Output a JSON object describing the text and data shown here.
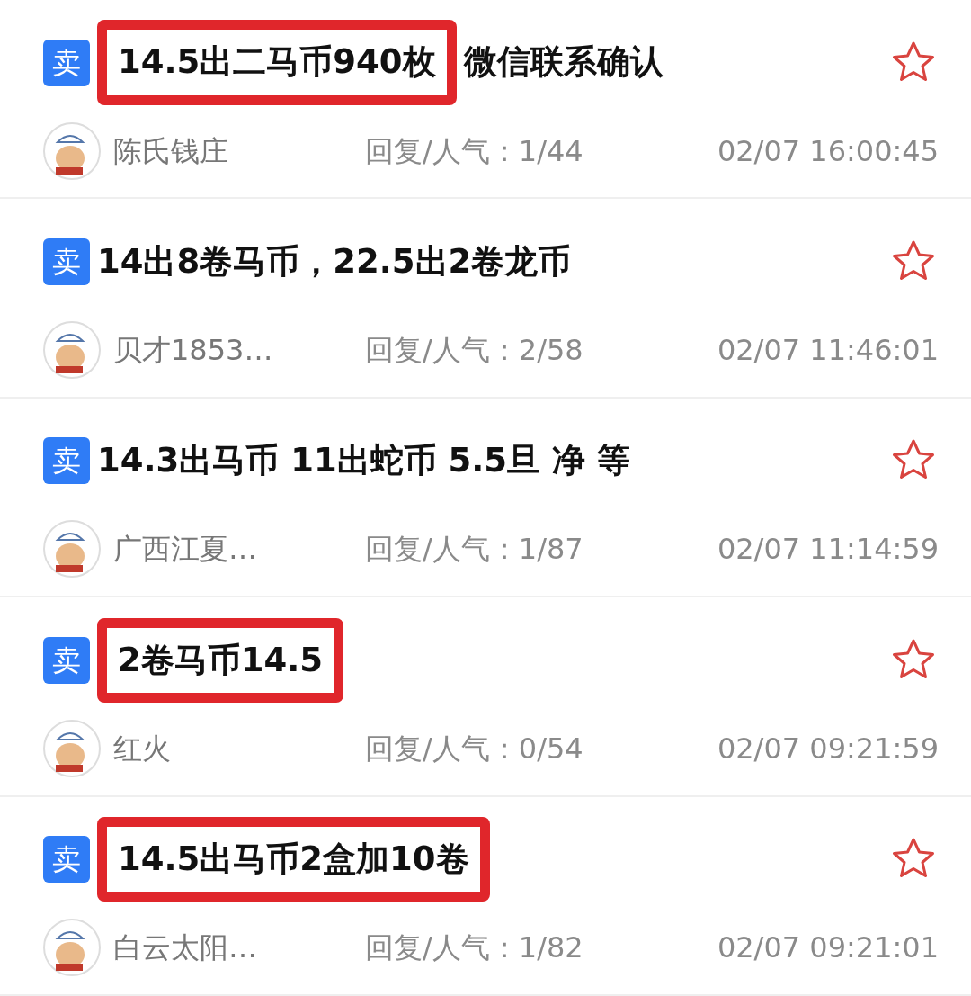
{
  "posts": [
    {
      "tag": "卖",
      "title_parts": [
        {
          "text": "14.5出二马币940枚",
          "highlighted": true
        },
        {
          "text": "微信联系确认",
          "highlighted": false
        }
      ],
      "author": "陈氏钱庄",
      "replies": "回复/人气：1/44",
      "time": "02/07 16:00:45",
      "favorited": false
    },
    {
      "tag": "卖",
      "title_parts": [
        {
          "text": "14出8卷马币，22.5出2卷龙币",
          "highlighted": false
        }
      ],
      "author": "贝才1853…",
      "replies": "回复/人气：2/58",
      "time": "02/07 11:46:01",
      "favorited": false
    },
    {
      "tag": "卖",
      "title_parts": [
        {
          "text": "14.3出马币 11出蛇币 5.5旦 净 等",
          "highlighted": false
        }
      ],
      "author": "广西江夏…",
      "replies": "回复/人气：1/87",
      "time": "02/07 11:14:59",
      "favorited": false
    },
    {
      "tag": "卖",
      "title_parts": [
        {
          "text": "2卷马币14.5",
          "highlighted": true
        }
      ],
      "author": "红火",
      "replies": "回复/人气：0/54",
      "time": "02/07 09:21:59",
      "favorited": false
    },
    {
      "tag": "卖",
      "title_parts": [
        {
          "text": "14.5出马币2盒加10卷",
          "highlighted": true
        }
      ],
      "author": "白云太阳…",
      "replies": "回复/人气：1/82",
      "time": "02/07 09:21:01",
      "favorited": false
    }
  ]
}
